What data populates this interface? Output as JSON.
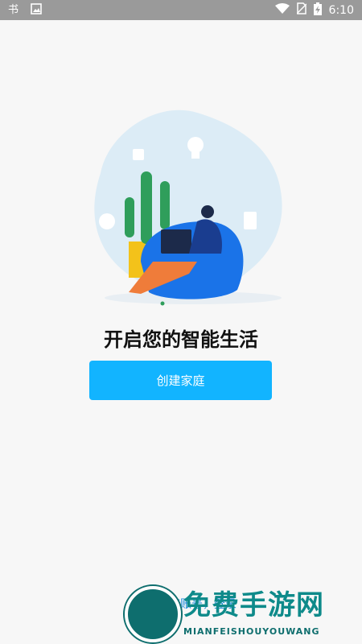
{
  "status_bar": {
    "time": "6:10",
    "icons": [
      "notification-icon",
      "image-icon",
      "wifi-icon",
      "no-sim-icon",
      "battery-charging-icon"
    ]
  },
  "main": {
    "title": "开启您的智能生活",
    "create_button_label": "创建家庭",
    "login_link_label": "已有账号，登录"
  },
  "watermark": {
    "cn": "免费手游网",
    "en": "MIANFEISHOUYOUWANG"
  },
  "colors": {
    "accent": "#12b4ff",
    "blob": "#dcecf6",
    "beanbag": "#1a73e8",
    "plant_pot": "#f3c21a"
  }
}
